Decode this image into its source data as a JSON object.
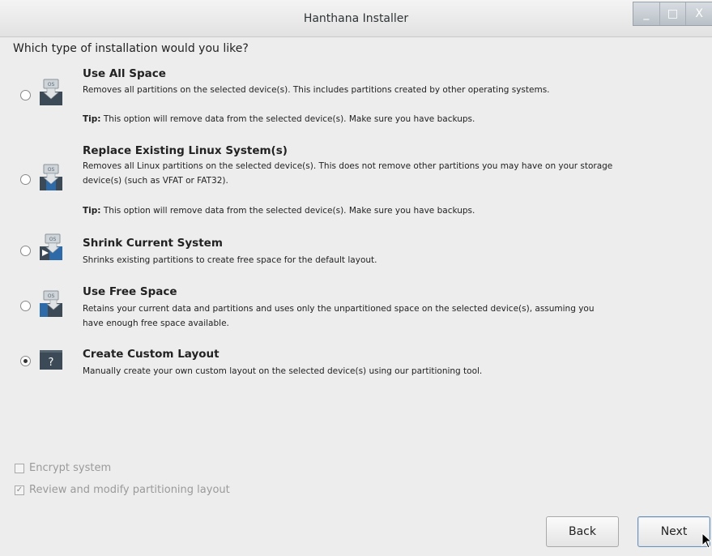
{
  "window": {
    "title": "Hanthana Installer",
    "controls": [
      "_",
      "□",
      "X"
    ]
  },
  "question": "Which type of installation would you like?",
  "options": [
    {
      "title": "Use All Space",
      "description": "Removes all partitions on the selected device(s).  This includes partitions created by other operating systems.",
      "tip_label": "Tip:",
      "tip": " This option will remove data from the selected device(s).  Make sure you have backups.",
      "icon": "os-disk-all-icon",
      "selected": false
    },
    {
      "title": "Replace Existing Linux System(s)",
      "description": "Removes all Linux partitions on the selected device(s). This does not remove other partitions you may have on your storage device(s) (such as VFAT or FAT32).",
      "tip_label": "Tip:",
      "tip": " This option will remove data from the selected device(s).  Make sure you have backups.",
      "icon": "os-disk-replace-icon",
      "selected": false
    },
    {
      "title": "Shrink Current System",
      "description": "Shrinks existing partitions to create free space for the default layout.",
      "icon": "os-disk-shrink-icon",
      "selected": false
    },
    {
      "title": "Use Free Space",
      "description": "Retains your current data and partitions and uses only the unpartitioned space on the selected device(s), assuming you have enough free space available.",
      "icon": "os-disk-free-icon",
      "selected": false
    },
    {
      "title": "Create Custom Layout",
      "description": "Manually create your own custom layout on the selected device(s) using our partitioning tool.",
      "icon": "question-disk-icon",
      "icon_glyph": "?",
      "selected": true
    }
  ],
  "encrypt": {
    "label": "Encrypt system",
    "checked": false,
    "enabled": false
  },
  "review": {
    "label": "Review and modify partitioning layout",
    "checked": true,
    "enabled": false
  },
  "buttons": {
    "back": "Back",
    "next": "Next"
  },
  "os_icon_label": "OS",
  "colors": {
    "icon_blue": "#2f6aa8",
    "icon_dark": "#2d3a44"
  }
}
